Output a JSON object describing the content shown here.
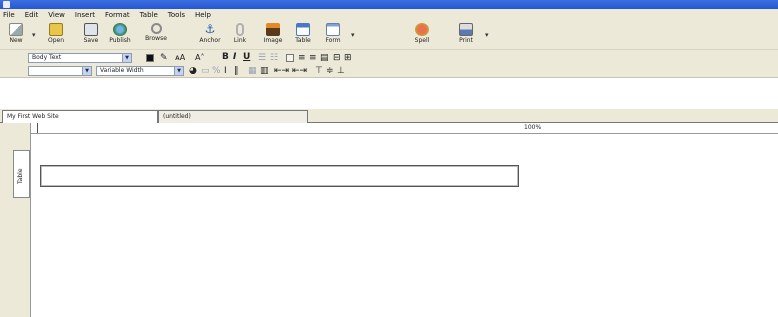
{
  "titlebar": {
    "title": ""
  },
  "menu": [
    "File",
    "Edit",
    "View",
    "Insert",
    "Format",
    "Table",
    "Tools",
    "Help"
  ],
  "toolbar": {
    "buttons": [
      {
        "label": "New",
        "icon": "new-page-icon"
      },
      {
        "label": "Open",
        "icon": "open-folder-icon"
      },
      {
        "label": "Save",
        "icon": "save-disk-icon"
      },
      {
        "label": "Publish",
        "icon": "globe-publish-icon"
      },
      {
        "label": "Browse",
        "icon": "magnifier-browse-icon"
      },
      {
        "label": "Anchor",
        "icon": "anchor-icon"
      },
      {
        "label": "Link",
        "icon": "link-icon"
      },
      {
        "label": "Image",
        "icon": "image-icon"
      },
      {
        "label": "Table",
        "icon": "table-icon"
      },
      {
        "label": "Form",
        "icon": "form-icon"
      },
      {
        "label": "Spell",
        "icon": "spell-check-icon"
      },
      {
        "label": "Print",
        "icon": "printer-icon"
      }
    ]
  },
  "format_toolbar": {
    "paragraph_style": "Body Text",
    "font": "Variable Width",
    "bold": "B",
    "italic": "I",
    "underline": "U"
  },
  "tabs": [
    {
      "label": "My First Web Site",
      "active": true
    },
    {
      "label": "(untitled)",
      "active": false
    }
  ],
  "ruler": {
    "label": "100%"
  },
  "side_tab": {
    "label": "Table"
  }
}
